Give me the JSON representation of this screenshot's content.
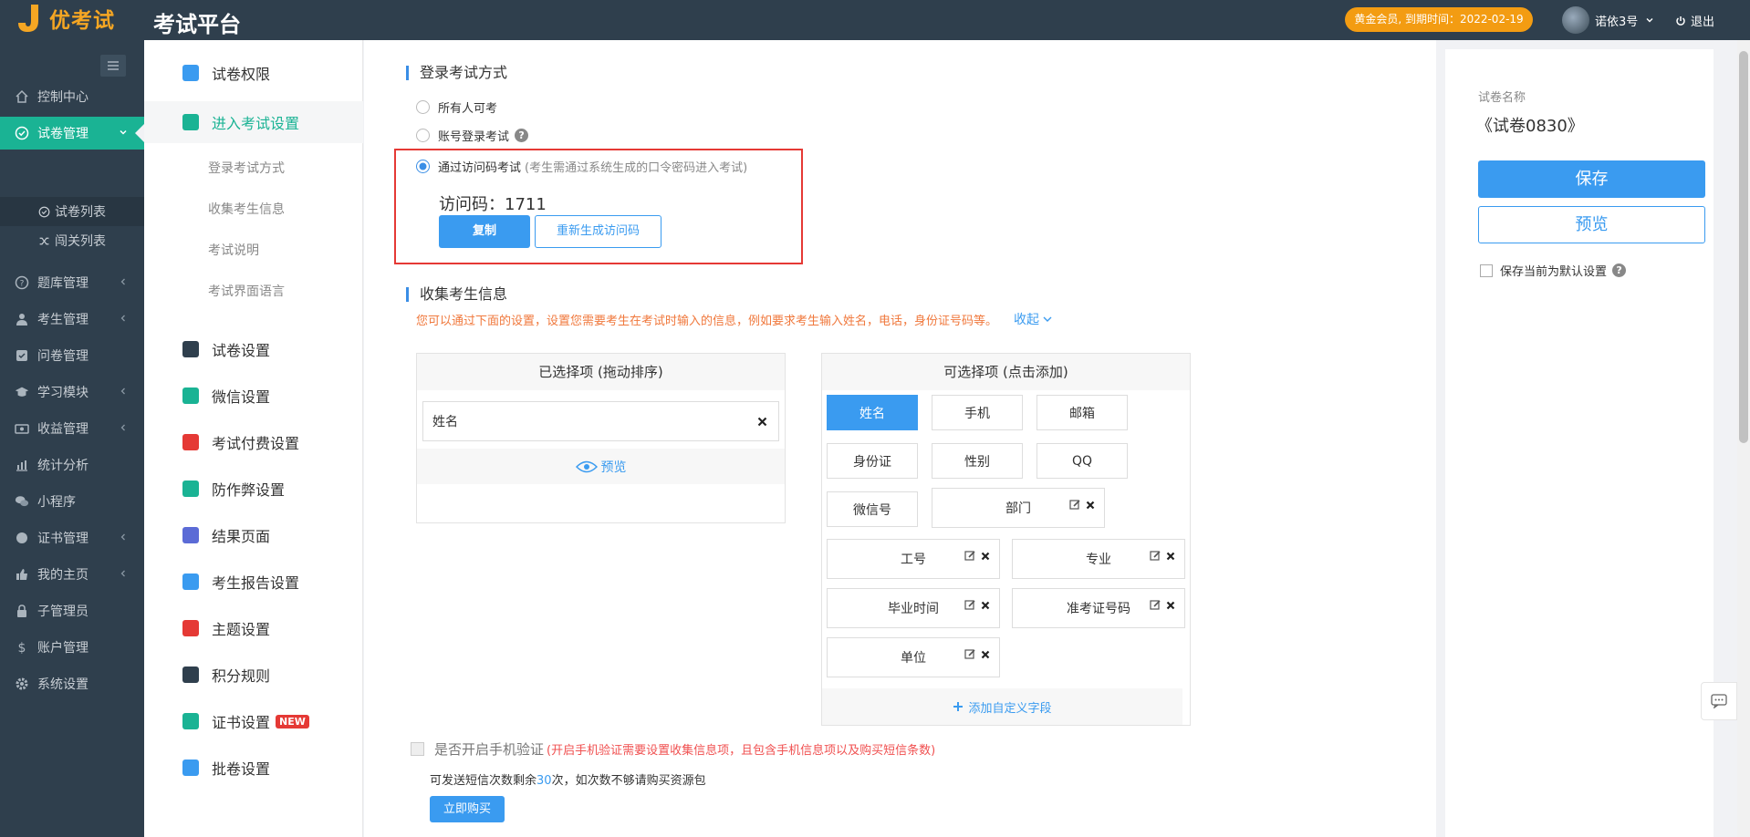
{
  "topbar": {
    "logo_text": "优考试",
    "title": "考试平台",
    "member_badge": "黄金会员, 到期时间：2022-02-19",
    "username": "诺依3号",
    "logout": "退出"
  },
  "sidebar": {
    "items": [
      {
        "label": "控制中心",
        "icon": "home-icon"
      },
      {
        "label": "试卷管理",
        "icon": "check-circle-icon"
      },
      {
        "label": "题库管理",
        "icon": "question-circle-icon"
      },
      {
        "label": "考生管理",
        "icon": "user-icon"
      },
      {
        "label": "问卷管理",
        "icon": "checkbox-icon"
      },
      {
        "label": "学习模块",
        "icon": "graduation-cap-icon"
      },
      {
        "label": "收益管理",
        "icon": "money-icon"
      },
      {
        "label": "统计分析",
        "icon": "bar-chart-icon"
      },
      {
        "label": "小程序",
        "icon": "wechat-icon"
      },
      {
        "label": "证书管理",
        "icon": "certificate-icon"
      },
      {
        "label": "我的主页",
        "icon": "thumb-icon"
      },
      {
        "label": "子管理员",
        "icon": "lock-icon"
      },
      {
        "label": "账户管理",
        "icon": "dollar-icon"
      },
      {
        "label": "系统设置",
        "icon": "gear-icon"
      }
    ],
    "sub_items": [
      {
        "label": "试卷列表"
      },
      {
        "label": "闯关列表"
      }
    ]
  },
  "subpanel": {
    "items": [
      {
        "label": "试卷权限",
        "color": "#3a9bf0"
      },
      {
        "label": "进入考试设置",
        "color": "#1ab394"
      },
      {
        "label": "试卷设置",
        "color": "#2f3f4d"
      },
      {
        "label": "微信设置",
        "color": "#1ab394"
      },
      {
        "label": "考试付费设置",
        "color": "#e53935"
      },
      {
        "label": "防作弊设置",
        "color": "#1ab394"
      },
      {
        "label": "结果页面",
        "color": "#5b6bd6"
      },
      {
        "label": "考生报告设置",
        "color": "#3a9bf0"
      },
      {
        "label": "主题设置",
        "color": "#e53935"
      },
      {
        "label": "积分规则",
        "color": "#2f3f4d"
      },
      {
        "label": "证书设置",
        "color": "#1ab394"
      },
      {
        "label": "批卷设置",
        "color": "#3a9bf0"
      }
    ],
    "sub_items": [
      {
        "label": "登录考试方式"
      },
      {
        "label": "收集考生信息"
      },
      {
        "label": "考试说明"
      },
      {
        "label": "考试界面语言"
      }
    ],
    "new_badge": "NEW"
  },
  "login_section": {
    "title": "登录考试方式",
    "options": [
      {
        "label": "所有人可考",
        "hint": ""
      },
      {
        "label": "账号登录考试",
        "hint": ""
      },
      {
        "label": "通过访问码考试",
        "hint": "(考生需通过系统生成的口令密码进入考试)"
      }
    ],
    "selected_index": 2,
    "access_code_label": "访问码：",
    "access_code": "1711",
    "copy_button": "复制",
    "regenerate_button": "重新生成访问码"
  },
  "collect_section": {
    "title": "收集考生信息",
    "description": "您可以通过下面的设置，设置您需要考生在考试时输入的信息，例如要求考生输入姓名，电话，身份证号码等。",
    "collapse": "收起",
    "selected_panel": {
      "title": "已选择项 (拖动排序)",
      "items": [
        "姓名"
      ],
      "preview": "预览"
    },
    "available_panel": {
      "title": "可选择项 (点击添加)",
      "options": [
        "姓名",
        "手机",
        "邮箱",
        "身份证",
        "性别",
        "QQ",
        "微信号",
        "部门",
        "工号",
        "专业",
        "毕业时间",
        "准考证号码",
        "单位"
      ],
      "add_custom": "添加自定义字段"
    }
  },
  "phone_verify": {
    "label": "是否开启手机验证",
    "note": "(开启手机验证需要设置收集信息项，且包含手机信息项以及购买短信条数)",
    "sms_prefix": "可发送短信次数剩余",
    "sms_count": "30",
    "sms_suffix": "次，如次数不够请购买资源包",
    "buy_button": "立即购买"
  },
  "right_panel": {
    "paper_name_label": "试卷名称",
    "paper_name": "《试卷0830》",
    "save_button": "保存",
    "preview_button": "预览",
    "default_checkbox": "保存当前为默认设置"
  },
  "colors": {
    "accent": "#1ab394",
    "primary": "#3a9bf0",
    "sidebar": "#2f3f4d",
    "badge": "#f39c12",
    "warning_text": "#f0783c",
    "error_text": "#e53935"
  }
}
